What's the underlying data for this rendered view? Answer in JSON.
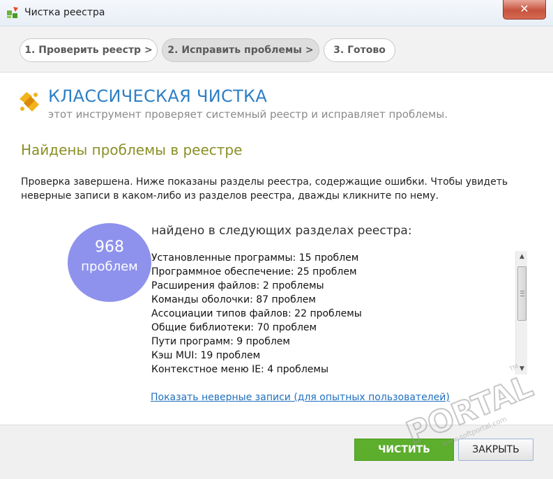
{
  "window": {
    "title": "Чистка реестра",
    "close_glyph": "✕"
  },
  "steps": [
    {
      "label": "1. Проверить реестр >"
    },
    {
      "label": "2. Исправить проблемы >"
    },
    {
      "label": "3. Готово"
    }
  ],
  "header": {
    "title": "КЛАССИЧЕСКАЯ ЧИСТКА",
    "subtitle": "этот инструмент проверяет системный реестр и исправляет проблемы."
  },
  "content": {
    "found_title": "Найдены проблемы в реестре",
    "description": "Проверка завершена. Ниже показаны разделы реестра, содержащие ошибки. Чтобы увидеть неверные записи в каком-либо из разделов реестра, дважды кликните по нему.",
    "count": "968",
    "count_label": "проблем",
    "sections_title": "найдено в следующих разделах реестра:",
    "items": [
      "Установленные программы: 15 проблем",
      "Программное обеспечение: 25 проблем",
      "Расширения файлов: 2 проблемы",
      "Команды оболочки: 87 проблем",
      "Ассоциации типов файлов: 22 проблемы",
      "Общие библиотеки: 70 проблем",
      "Пути программ: 9 проблем",
      "Кэш MUI: 19 проблем",
      "Контекстное меню IE: 4 проблемы"
    ],
    "advanced_link": "Показать неверные записи (для опытных пользователей)"
  },
  "buttons": {
    "clean": "ЧИСТИТЬ",
    "close": "ЗАКРЫТЬ"
  },
  "watermark": {
    "brand": "PORTAL",
    "tm": "TM",
    "url": "www.softportal.com"
  },
  "colors": {
    "accent_blue": "#2d7fc5",
    "olive": "#8a8f25",
    "circle": "#8e92ec",
    "clean_button": "#5cae2c"
  }
}
